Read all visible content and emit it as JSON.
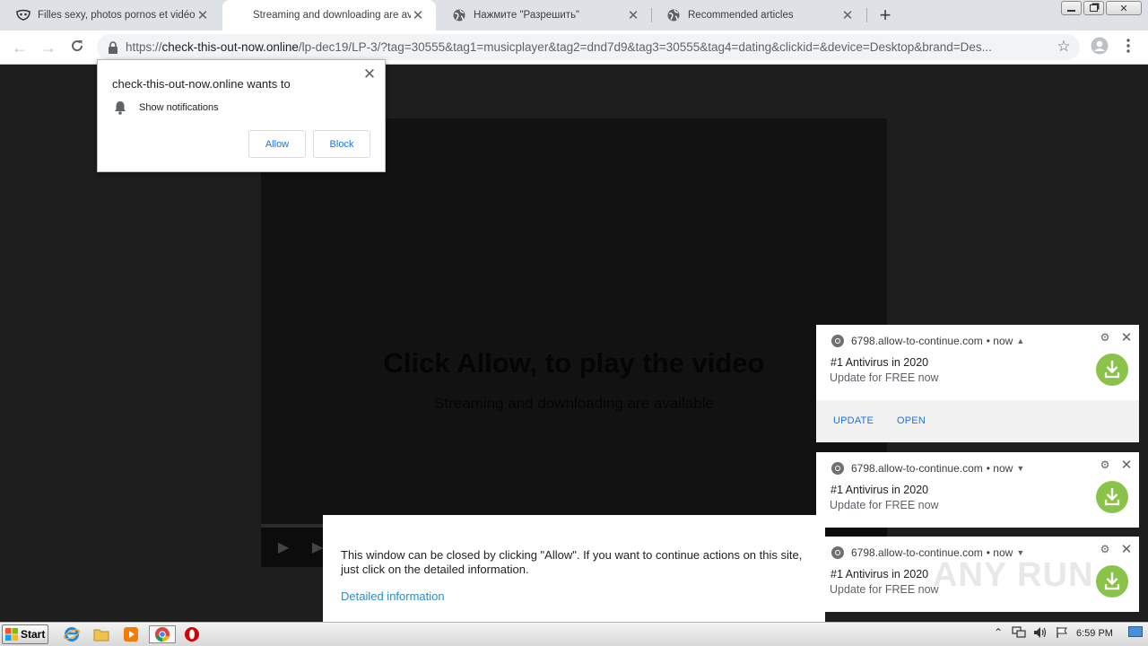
{
  "tabs": [
    {
      "title": "Filles sexy, photos pornos et vidéos",
      "active": false,
      "favicon": "mask-icon"
    },
    {
      "title": "Streaming and downloading are available",
      "active": true,
      "favicon": "none"
    },
    {
      "title": "Нажмите \"Разрешить\"",
      "active": false,
      "favicon": "globe-icon"
    },
    {
      "title": "Recommended articles",
      "active": false,
      "favicon": "globe-icon"
    }
  ],
  "omnibox": {
    "scheme": "https://",
    "host": "check-this-out-now.online",
    "path": "/lp-dec19/LP-3/?tag=30555&tag1=musicplayer&tag2=dnd7d9&tag3=30555&tag4=dating&clickid=&device=Desktop&brand=Des..."
  },
  "permission": {
    "title": "check-this-out-now.online wants to",
    "item": "Show notifications",
    "allow": "Allow",
    "block": "Block"
  },
  "player": {
    "headline": "Click Allow, to play the video",
    "subtitle": "Streaming and downloading are available"
  },
  "banner": {
    "text": "This window can be closed by clicking \"Allow\". If you want to continue actions on this site, just click on the detailed information.",
    "link": "Detailed information"
  },
  "notifications": [
    {
      "source": "6798.allow-to-continue.com",
      "time": "• now",
      "title": "#1 Antivirus in 2020",
      "body": "Update for FREE now",
      "expanded": true,
      "actions": [
        "UPDATE",
        "OPEN"
      ]
    },
    {
      "source": "6798.allow-to-continue.com",
      "time": "• now",
      "title": "#1 Antivirus in 2020",
      "body": "Update for FREE now",
      "expanded": false
    },
    {
      "source": "6798.allow-to-continue.com",
      "time": "• now",
      "title": "#1 Antivirus in 2020",
      "body": "Update for FREE now",
      "expanded": false
    }
  ],
  "watermark": "ANY RUN",
  "taskbar": {
    "start": "Start",
    "clock": "6:59 PM"
  },
  "colors": {
    "accent_blue": "#1a73e8",
    "link_blue": "#2a8fc7",
    "page_bg": "#1e1e1e",
    "download_green": "#8bc34a"
  }
}
